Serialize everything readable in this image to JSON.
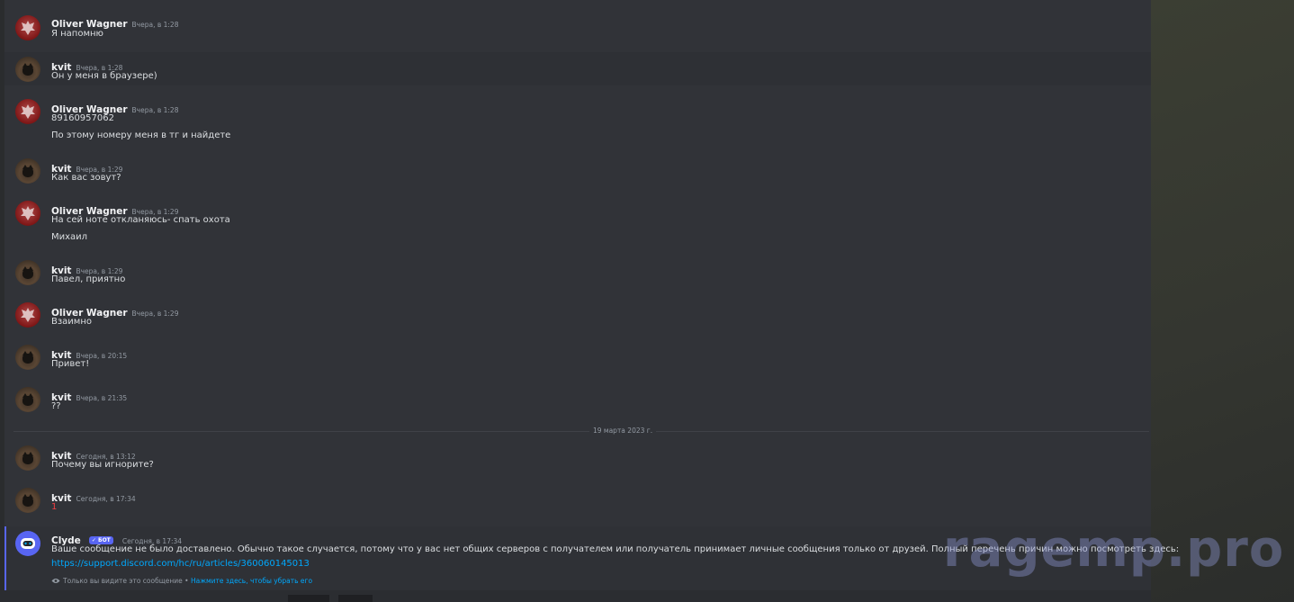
{
  "messages": [
    {
      "author": "Oliver Wagner",
      "timestamp": "Вчера, в 1:28",
      "lines": [
        "Я напомню"
      ]
    },
    {
      "author": "kvit",
      "timestamp": "Вчера, в 1:28",
      "lines": [
        "Он у меня в браузере)"
      ]
    },
    {
      "author": "Oliver Wagner",
      "timestamp": "Вчера, в 1:28",
      "lines": [
        "89160957062",
        "По этому номеру меня в тг и найдете"
      ]
    },
    {
      "author": "kvit",
      "timestamp": "Вчера, в 1:29",
      "lines": [
        "Как вас зовут?"
      ]
    },
    {
      "author": "Oliver Wagner",
      "timestamp": "Вчера, в 1:29",
      "lines": [
        "На сей ноте откланяюсь- спать охота",
        "Михаил"
      ]
    },
    {
      "author": "kvit",
      "timestamp": "Вчера, в 1:29",
      "lines": [
        "Павел, приятно"
      ]
    },
    {
      "author": "Oliver Wagner",
      "timestamp": "Вчера, в 1:29",
      "lines": [
        "Взаимно"
      ]
    },
    {
      "author": "kvit",
      "timestamp": "Вчера, в 20:15",
      "lines": [
        "Привет!"
      ]
    },
    {
      "author": "kvit",
      "timestamp": "Вчера, в 21:35",
      "lines": [
        "??"
      ]
    },
    {
      "author": "kvit",
      "timestamp": "Сегодня, в 13:12",
      "lines": [
        "Почему вы игнорите?"
      ]
    },
    {
      "author": "kvit",
      "timestamp": "Сегодня, в 17:34",
      "lines": [
        "1"
      ]
    }
  ],
  "date_divider": "19 марта 2023 г.",
  "clyde": {
    "author": "Clyde",
    "bot_tag": "✓ БОТ",
    "timestamp": "Сегодня, в 17:34",
    "text": "Ваше сообщение не было доставлено. Обычно такое случается, потому что у вас нет общих серверов с получателем или получатель принимает личные сообщения только от друзей. Полный перечень причин можно посмотреть здесь:",
    "link": "https://support.discord.com/hc/ru/articles/360060145013",
    "ephemeral_note": "Только вы видите это сообщение",
    "separator": " • ",
    "dismiss_label": "Нажмите здесь, чтобы убрать его"
  },
  "watermark": "ragemp.pro",
  "colors": {
    "accent": "#5865f2",
    "link": "#00a8fc",
    "background": "#313338",
    "error_text": "#f23f43"
  }
}
